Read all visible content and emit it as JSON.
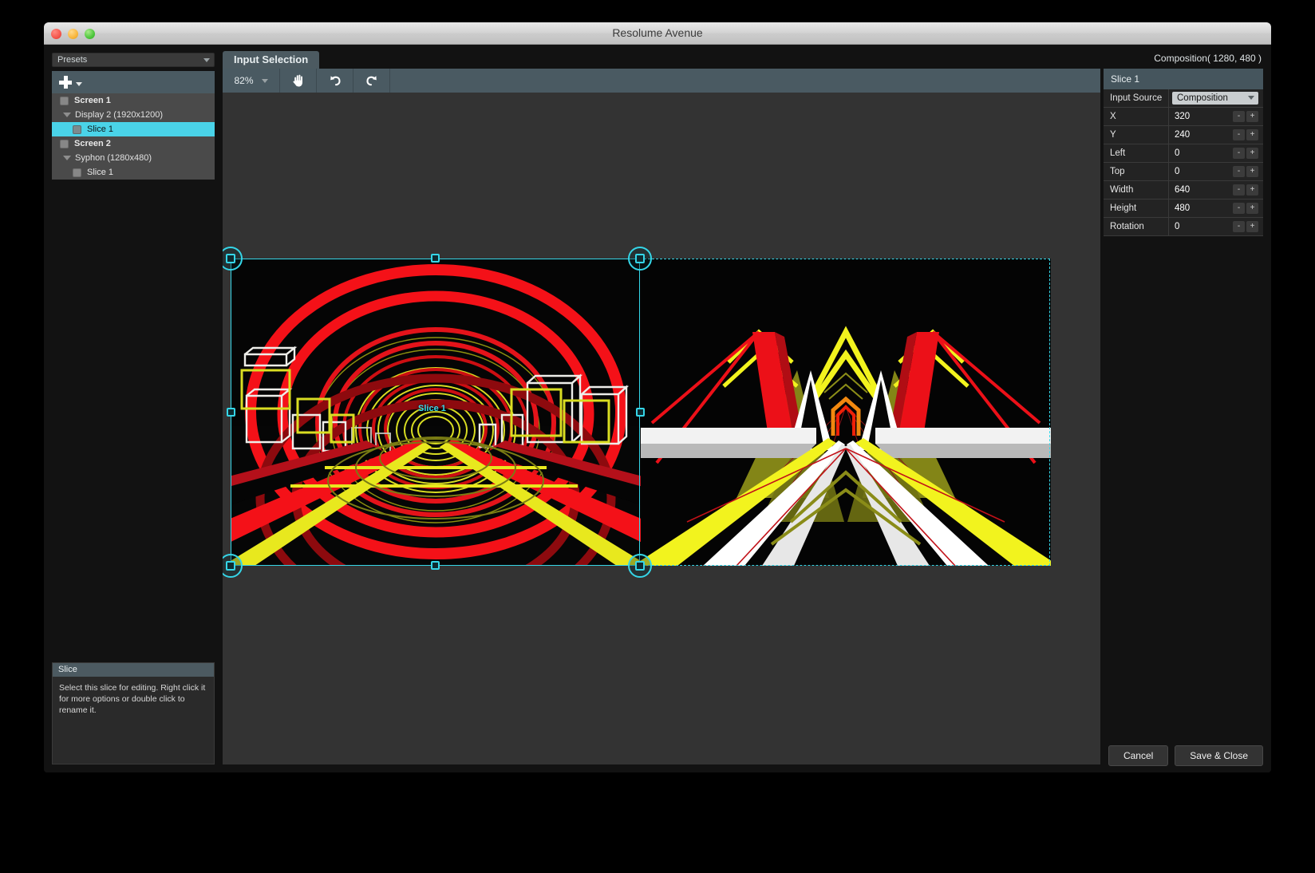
{
  "window": {
    "title": "Resolume Avenue",
    "traffic_lights": [
      "close-red",
      "minimize-yellow",
      "zoom-green"
    ]
  },
  "left_panel": {
    "presets_label": "Presets",
    "add_button_label": "+",
    "tree": [
      {
        "label": "Screen 1",
        "type": "screen",
        "checkbox": true,
        "selected": false
      },
      {
        "label": "Display 2 (1920x1200)",
        "type": "output",
        "disclosure": true,
        "selected": false
      },
      {
        "label": "Slice 1",
        "type": "slice",
        "checkbox": true,
        "selected": true
      },
      {
        "label": "Screen 2",
        "type": "screen",
        "checkbox": true,
        "selected": false
      },
      {
        "label": "Syphon (1280x480)",
        "type": "output",
        "disclosure": true,
        "selected": false
      },
      {
        "label": "Slice 1",
        "type": "slice",
        "checkbox": true,
        "selected": false
      }
    ],
    "info": {
      "title": "Slice",
      "text": "Select this slice for editing. Right click it for more options or double click to rename it."
    }
  },
  "center": {
    "tab_label": "Input Selection",
    "composition_label": "Composition( 1280, 480 )",
    "toolbar": {
      "zoom_value": "82%",
      "zoom_caret": "chevron-down-icon",
      "pan_tool": "hand-icon",
      "undo": "undo-icon",
      "redo": "redo-icon"
    },
    "canvas": {
      "slice_overlay_label": "Slice 1",
      "accent_color": "#35d6e8"
    }
  },
  "right_panel": {
    "title": "Slice 1",
    "rows": [
      {
        "label": "Input Source",
        "value": "Composition",
        "control": "select"
      },
      {
        "label": "X",
        "value": "320",
        "control": "spinner"
      },
      {
        "label": "Y",
        "value": "240",
        "control": "spinner"
      },
      {
        "label": "Left",
        "value": "0",
        "control": "spinner"
      },
      {
        "label": "Top",
        "value": "0",
        "control": "spinner"
      },
      {
        "label": "Width",
        "value": "640",
        "control": "spinner"
      },
      {
        "label": "Height",
        "value": "480",
        "control": "spinner"
      },
      {
        "label": "Rotation",
        "value": "0",
        "control": "spinner"
      }
    ],
    "spinner_minus": "-",
    "spinner_plus": "+"
  },
  "footer": {
    "cancel_label": "Cancel",
    "save_label": "Save & Close"
  }
}
